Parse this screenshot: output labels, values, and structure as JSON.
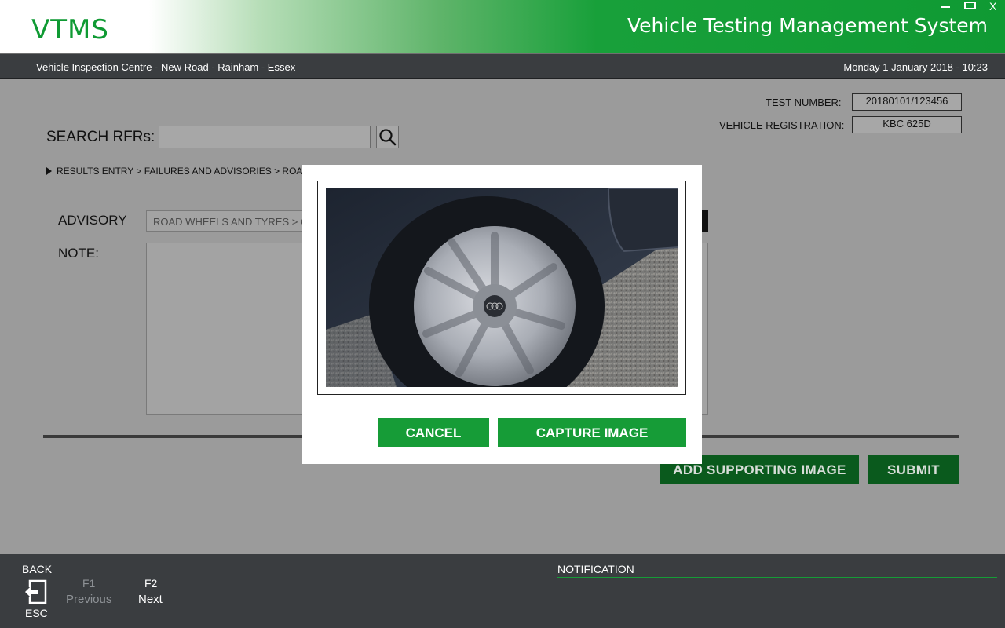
{
  "header": {
    "logo": "VTMS",
    "title": "Vehicle Testing Management System",
    "window_close": "X"
  },
  "location_bar": {
    "location": "Vehicle Inspection Centre - New Road - Rainham - Essex",
    "datetime": "Monday 1 January 2018 - 10:23"
  },
  "test_info": {
    "test_number_label": "TEST NUMBER:",
    "test_number": "20180101/123456",
    "registration_label": "VEHICLE REGISTRATION:",
    "registration": "KBC 625D"
  },
  "search": {
    "label": "SEARCH RFRs:",
    "value": "",
    "icon": "search-icon"
  },
  "breadcrumb": {
    "text": "RESULTS ENTRY > FAILURES  AND ADVISORIES > ROAD"
  },
  "form": {
    "advisory_label": "ADVISORY",
    "advisory_value": "ROAD WHEELS AND TYRES > C",
    "note_label": "NOTE:"
  },
  "actions": {
    "add_image": "ADD SUPPORTING IMAGE",
    "submit": "SUBMIT"
  },
  "modal": {
    "cancel": "CANCEL",
    "capture": "CAPTURE IMAGE"
  },
  "footer": {
    "back_label": "BACK",
    "esc_label": "ESC",
    "f1_key": "F1",
    "f1_label": "Previous",
    "f2_key": "F2",
    "f2_label": "Next",
    "notification_label": "NOTIFICATION"
  },
  "colors": {
    "brand_green": "#169c37",
    "dark_green": "#0a5a1d",
    "bar_gray": "#3a3d40"
  }
}
